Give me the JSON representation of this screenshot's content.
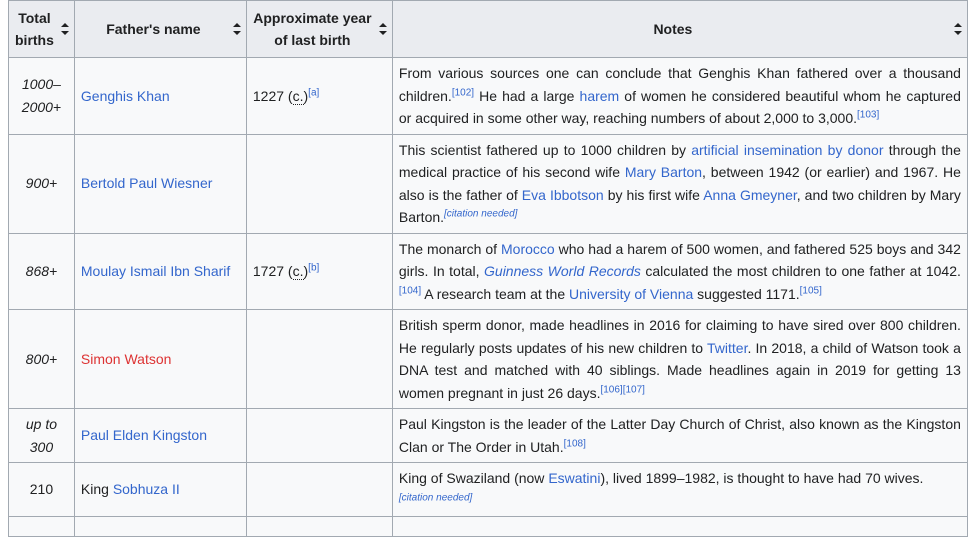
{
  "headers": {
    "total_births": "Total births",
    "father_name": "Father's name",
    "last_birth": "Approximate year of last birth",
    "notes": "Notes"
  },
  "rows": [
    {
      "births": "1000–2000+",
      "father": "Genghis Khan",
      "year": "1227",
      "circa": "c.",
      "note_ref": "[a]",
      "notes": {
        "t1": "From various sources one can conclude that Genghis Khan fathered over a thousand children.",
        "ref1": "[102]",
        "t2": " He had a large ",
        "link1": "harem",
        "t3": " of women he considered beautiful whom he captured or acquired in some other way, reaching numbers of about 2,000 to 3,000.",
        "ref2": "[103]"
      }
    },
    {
      "births": "900+",
      "father": "Bertold Paul Wiesner",
      "notes": {
        "t1": "This scientist fathered up to 1000 children by ",
        "link1": "artificial insemination by donor",
        "t2": " through the medical practice of his second wife ",
        "link2": "Mary Barton",
        "t3": ", between 1942 (or earlier) and 1967. He also is the father of ",
        "link3": "Eva Ibbotson",
        "t4": " by his first wife ",
        "link4": "Anna Gmeyner",
        "t5": ", and two children by Mary Barton.",
        "cn": "[citation needed]"
      }
    },
    {
      "births": "868+",
      "father": "Moulay Ismail Ibn Sharif",
      "year": "1727",
      "circa": "c.",
      "note_ref": "[b]",
      "notes": {
        "t1": "The monarch of ",
        "link1": "Morocco",
        "t2": " who had a harem of 500 women, and fathered 525 boys and 342 girls. In total, ",
        "link2": "Guinness World Records",
        "t3": " calculated the most children to one father at 1042.",
        "ref1": "[104]",
        "t4": " A research team at the ",
        "link3": "University of Vienna",
        "t5": " suggested 1171.",
        "ref2": "[105]"
      }
    },
    {
      "births": "800+",
      "father": "Simon Watson",
      "notes": {
        "t1": "British sperm donor, made headlines in 2016 for claiming to have sired over 800 children. He regularly posts updates of his new children to ",
        "link1": "Twitter",
        "t2": ". In 2018, a child of Watson took a DNA test and matched with 40 siblings. Made headlines again in 2019 for getting 13 women pregnant in just 26 days.",
        "ref1": "[106]",
        "ref2": "[107]"
      }
    },
    {
      "births": "up to 300",
      "father": "Paul Elden Kingston",
      "notes": {
        "t1": "Paul Kingston is the leader of the Latter Day Church of Christ, also known as the Kingston Clan or The Order in Utah.",
        "ref1": "[108]"
      }
    },
    {
      "births": "210",
      "father_prefix": "King ",
      "father": "Sobhuza II",
      "notes": {
        "t1": "King of Swaziland (now ",
        "link1": "Eswatini",
        "t2": "), lived 1899–1982, is thought to have had 70 wives.",
        "cn": "[citation needed]"
      }
    }
  ]
}
